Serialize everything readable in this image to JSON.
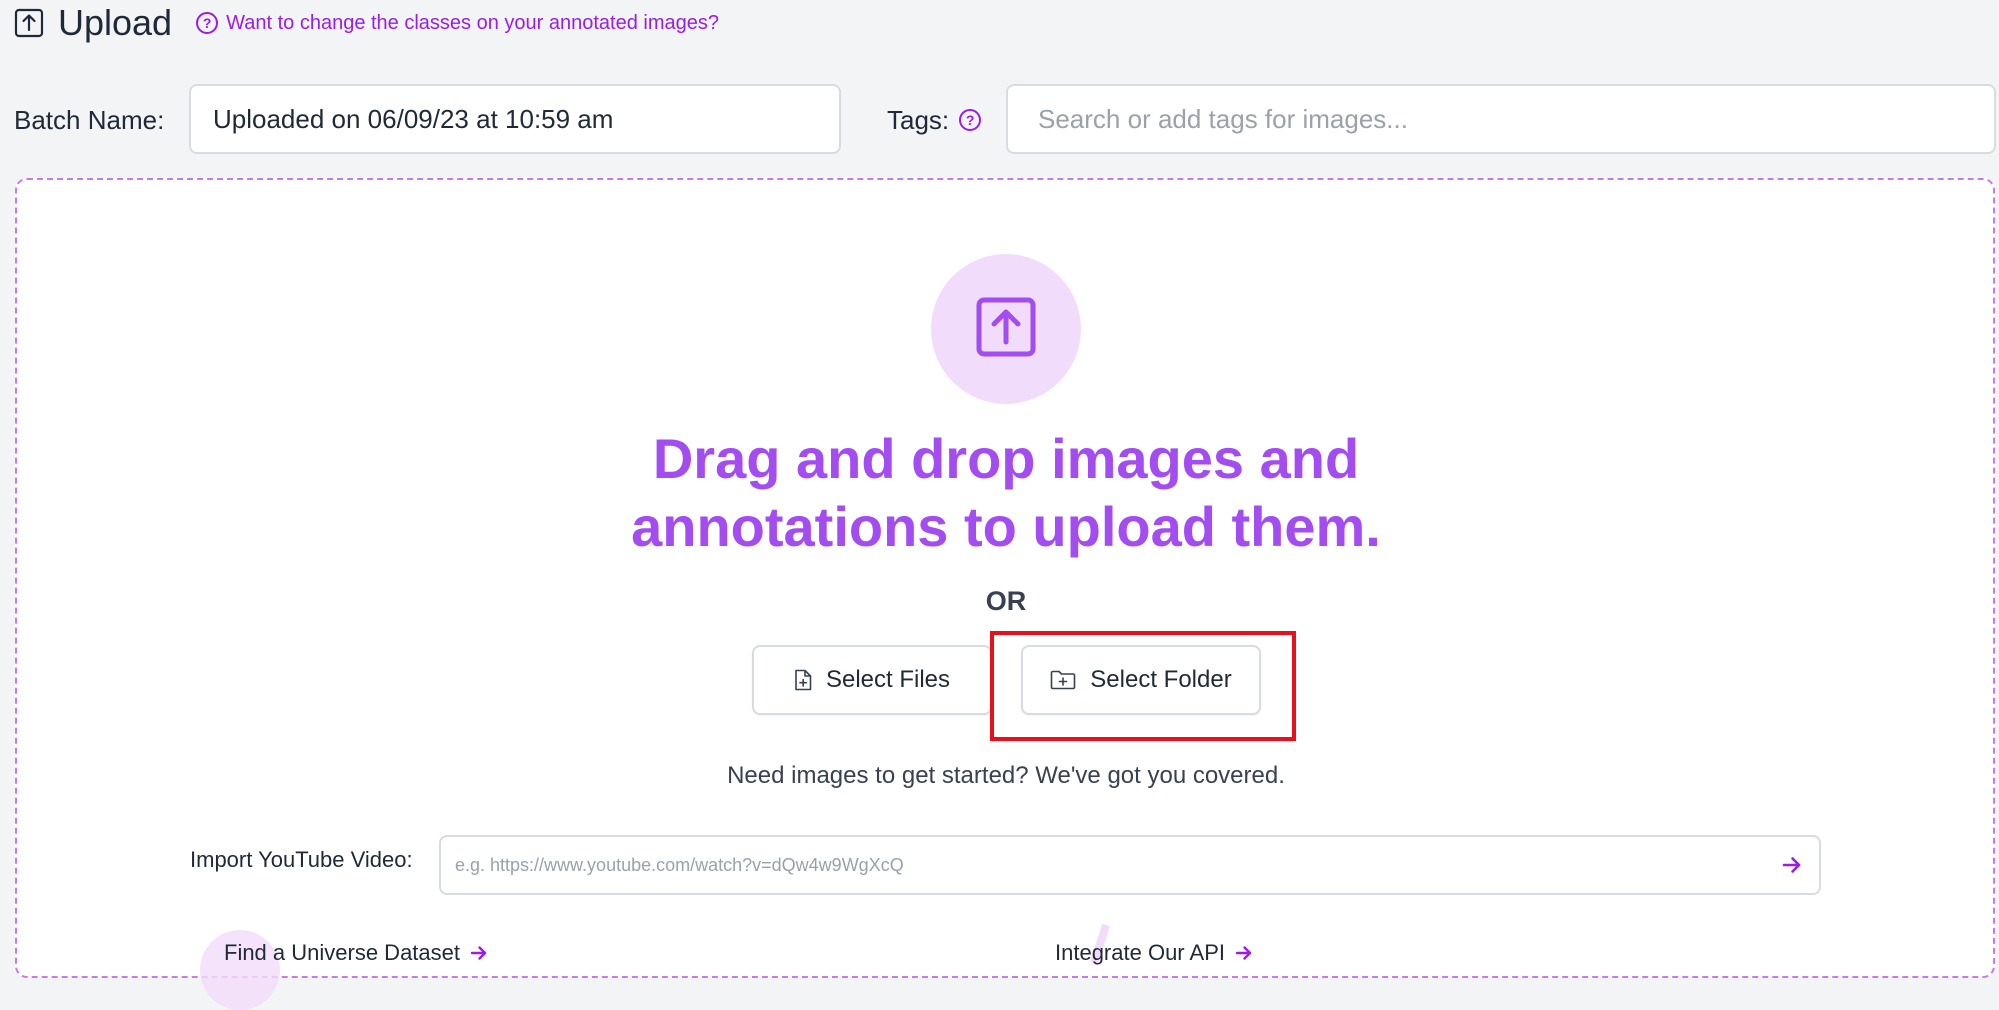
{
  "header": {
    "title": "Upload",
    "help_link": "Want to change the classes on your annotated images?"
  },
  "batch": {
    "label": "Batch Name:",
    "value": "Uploaded on 06/09/23 at 10:59 am"
  },
  "tags": {
    "label": "Tags:",
    "placeholder": "Search or add tags for images..."
  },
  "dropzone": {
    "title_line1": "Drag and drop images and",
    "title_line2": "annotations to upload them.",
    "or": "OR",
    "select_files": "Select Files",
    "select_folder": "Select Folder",
    "need_images": "Need images to get started? We've got you covered."
  },
  "youtube": {
    "label": "Import YouTube Video:",
    "placeholder": "e.g. https://www.youtube.com/watch?v=dQw4w9WgXcQ"
  },
  "links": {
    "universe": "Find a Universe Dataset",
    "api": "Integrate Our API"
  },
  "colors": {
    "accent": "#a34cf0",
    "accent_dark": "#9a1de6",
    "accent_light": "#f2dcfb",
    "highlight": "#e8101a",
    "background": "#f3f4f6"
  },
  "icons": {
    "header_icon": "upload-icon",
    "help_icon": "question-circle-icon",
    "big_icon": "upload-icon",
    "files_icon": "file-plus-icon",
    "folder_icon": "folder-plus-icon",
    "arrow_icon": "arrow-right-icon"
  }
}
